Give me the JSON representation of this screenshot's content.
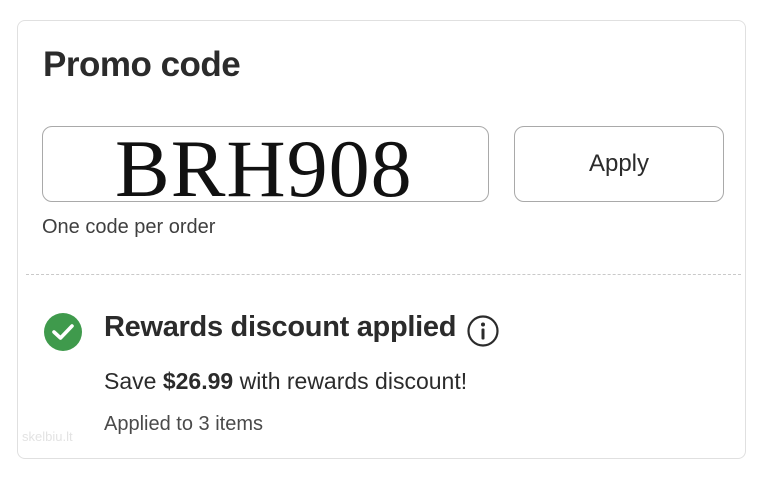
{
  "promo": {
    "title": "Promo code",
    "code_value": "BRH908",
    "apply_label": "Apply",
    "hint": "One code per order"
  },
  "rewards": {
    "title": "Rewards discount applied",
    "save_prefix": "Save ",
    "save_amount": "$26.99",
    "save_suffix": " with rewards discount!",
    "applied_to": "Applied to 3 items"
  },
  "watermark": "skelbiu.lt",
  "colors": {
    "success_green": "#3f9a4c",
    "text": "#2b2b2b",
    "border": "#a9a9a9"
  },
  "icons": {
    "status": "check-circle-icon",
    "info": "info-icon"
  }
}
